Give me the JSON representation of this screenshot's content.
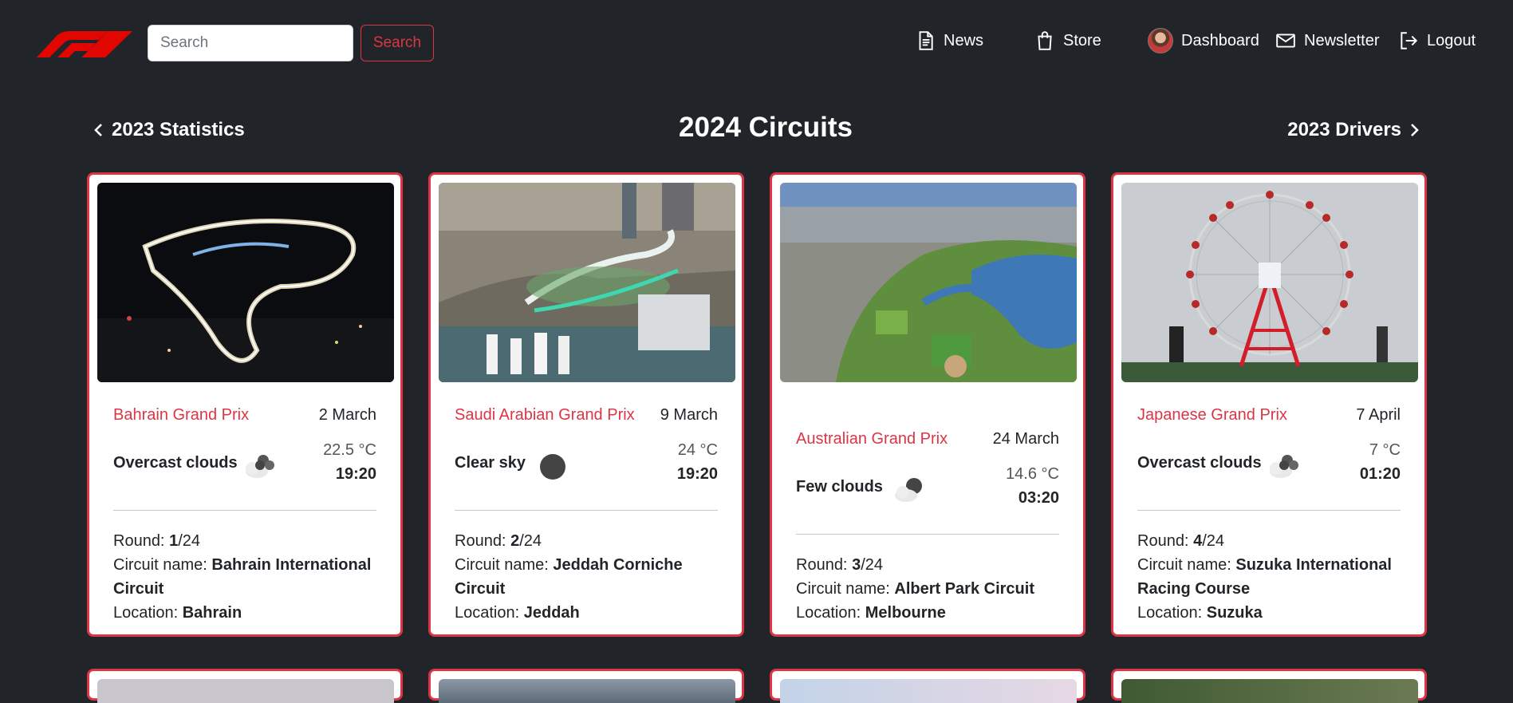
{
  "navbar": {
    "search_placeholder": "Search",
    "search_button": "Search",
    "links": {
      "news": "News",
      "store": "Store",
      "dashboard": "Dashboard",
      "newsletter": "Newsletter",
      "logout": "Logout"
    }
  },
  "header": {
    "prev_link": "2023 Statistics",
    "title": "2024 Circuits",
    "next_link": "2023 Drivers"
  },
  "colors": {
    "accent": "#dc3545",
    "background": "#212529"
  },
  "cards": [
    {
      "name": "Bahrain Grand Prix",
      "date": "2 March",
      "weather": "Overcast clouds",
      "weather_icon": "overcast-clouds-icon",
      "temperature": "22.5 °C",
      "time": "19:20",
      "round_label": "Round: ",
      "round": "1",
      "round_total": "/24",
      "circuit_label": "Circuit name: ",
      "circuit": "Bahrain International Circuit",
      "location_label": "Location: ",
      "location": "Bahrain"
    },
    {
      "name": "Saudi Arabian Grand Prix",
      "date": "9 March",
      "weather": "Clear sky",
      "weather_icon": "clear-sky-icon",
      "temperature": "24 °C",
      "time": "19:20",
      "round_label": "Round: ",
      "round": "2",
      "round_total": "/24",
      "circuit_label": "Circuit name: ",
      "circuit": "Jeddah Corniche Circuit",
      "location_label": "Location: ",
      "location": "Jeddah"
    },
    {
      "name": "Australian Grand Prix",
      "date": "24 March",
      "weather": "Few clouds",
      "weather_icon": "few-clouds-icon",
      "temperature": "14.6 °C",
      "time": "03:20",
      "round_label": "Round: ",
      "round": "3",
      "round_total": "/24",
      "circuit_label": "Circuit name: ",
      "circuit": "Albert Park Circuit",
      "location_label": "Location: ",
      "location": "Melbourne"
    },
    {
      "name": "Japanese Grand Prix",
      "date": "7 April",
      "weather": "Overcast clouds",
      "weather_icon": "overcast-clouds-icon",
      "temperature": "7 °C",
      "time": "01:20",
      "round_label": "Round: ",
      "round": "4",
      "round_total": "/24",
      "circuit_label": "Circuit name: ",
      "circuit": "Suzuka International Racing Course",
      "location_label": "Location: ",
      "location": "Suzuka"
    }
  ]
}
